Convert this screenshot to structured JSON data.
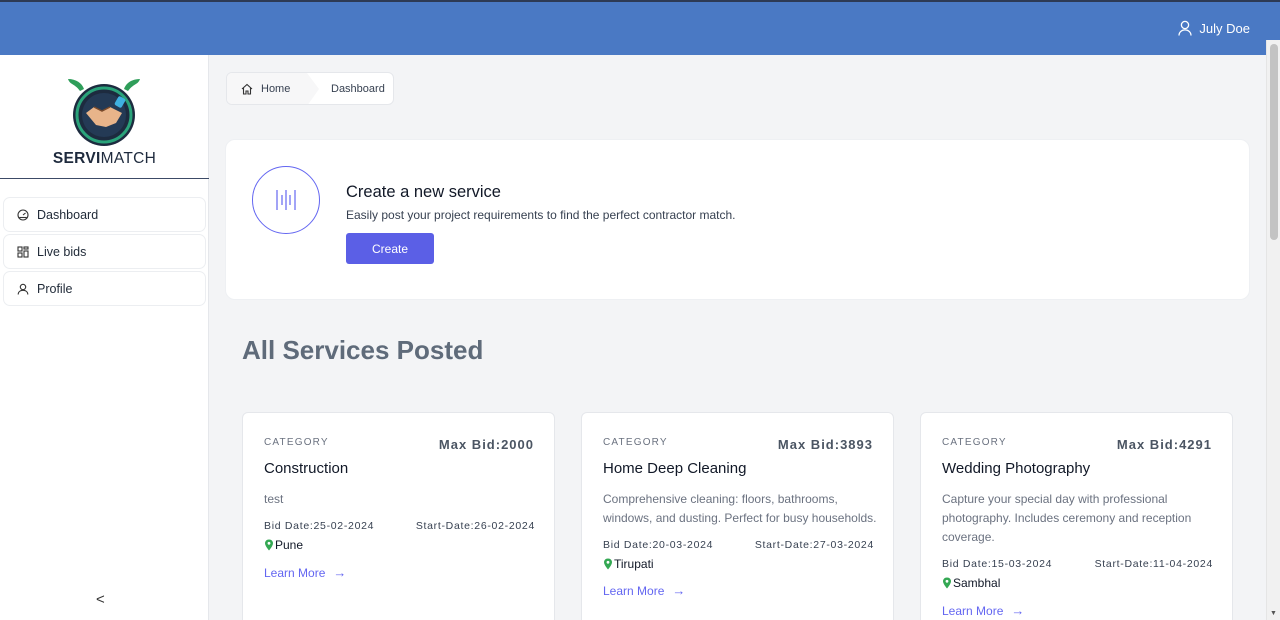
{
  "header": {
    "user_name": "July Doe"
  },
  "brand": {
    "name_bold": "SERVI",
    "name_light": "MATCH"
  },
  "sidebar": {
    "items": [
      {
        "label": "Dashboard",
        "icon": "dashboard-icon"
      },
      {
        "label": "Live bids",
        "icon": "grid-icon"
      },
      {
        "label": "Profile",
        "icon": "user-icon"
      }
    ],
    "collapse_icon": "<"
  },
  "breadcrumb": {
    "home": "Home",
    "current": "Dashboard"
  },
  "create_card": {
    "title": "Create a new service",
    "subtitle": "Easily post your project requirements to find the perfect contractor match.",
    "button": "Create"
  },
  "services_title": "All Services Posted",
  "services": [
    {
      "category_label": "CATEGORY",
      "max_bid": "Max Bid:2000",
      "title": "Construction",
      "description": "test",
      "bid_date": "Bid Date:25-02-2024",
      "start_date": "Start-Date:26-02-2024",
      "location": "Pune",
      "learn_more": "Learn More"
    },
    {
      "category_label": "CATEGORY",
      "max_bid": "Max Bid:3893",
      "title": "Home Deep Cleaning",
      "description": "Comprehensive cleaning: floors, bathrooms, windows, and dusting. Perfect for busy households.",
      "bid_date": "Bid Date:20-03-2024",
      "start_date": "Start-Date:27-03-2024",
      "location": "Tirupati",
      "learn_more": "Learn More"
    },
    {
      "category_label": "CATEGORY",
      "max_bid": "Max Bid:4291",
      "title": "Wedding Photography",
      "description": "Capture your special day with professional photography. Includes ceremony and reception coverage.",
      "bid_date": "Bid Date:15-03-2024",
      "start_date": "Start-Date:11-04-2024",
      "location": "Sambhal",
      "learn_more": "Learn More"
    }
  ],
  "colors": {
    "topbar": "#4a79c4",
    "accent": "#5b5fe6",
    "link": "#6366f1"
  }
}
